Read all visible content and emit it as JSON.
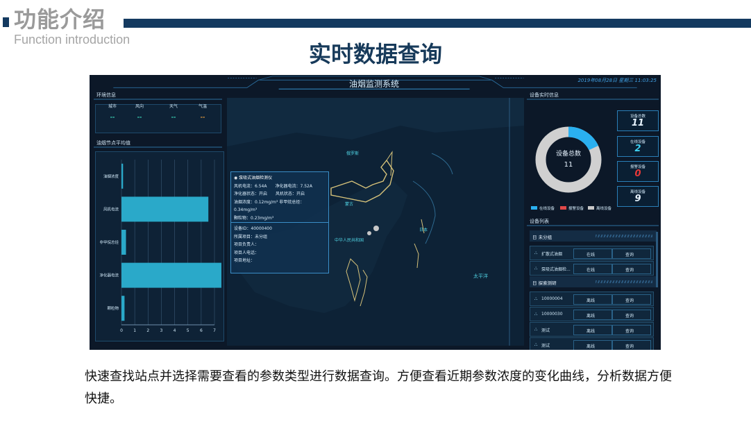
{
  "slide": {
    "title": "功能介绍",
    "subtitle": "Function introduction",
    "heading": "实时数据查询",
    "description": "快速查找站点并选择需要查看的参数类型进行数据查询。方便查看近期参数浓度的变化曲线，分析数据方便快捷。"
  },
  "app": {
    "title": "油烟监测系统",
    "datetime": "2019年08月28日 星期三 11:03:25"
  },
  "env": {
    "section_title": "环境信息",
    "columns": [
      {
        "label": "城市",
        "value": "--",
        "color": "#3fe0c0"
      },
      {
        "label": "风向",
        "value": "--",
        "color": "#3fe0c0"
      },
      {
        "label": "天气",
        "value": "--",
        "color": "#3fe0c0"
      },
      {
        "label": "气温",
        "value": "--",
        "color": "#f0a040"
      }
    ]
  },
  "avg": {
    "section_title": "油烟节点平均值",
    "chart_data": {
      "type": "bar",
      "orientation": "horizontal",
      "categories": [
        "油烟浓度",
        "风机电流",
        "非甲烷总烃",
        "净化器电流",
        "颗粒物"
      ],
      "values": [
        0.12,
        6.54,
        0.34,
        7.52,
        0.23
      ],
      "xticks": [
        "0",
        "1",
        "2",
        "3",
        "4",
        "5",
        "6",
        "7"
      ],
      "xlim": [
        0,
        7
      ],
      "color": "#2aa9c9"
    }
  },
  "map": {
    "labels": [
      "俄罗斯",
      "蒙古",
      "中华人民共和国",
      "日本",
      "太平洋"
    ],
    "popup1": {
      "device_name": "◉ 泵吸式油烟检测仪",
      "lines": [
        "风机电流：6.54A　　净化器电流：7.52A",
        "净化器状态：开启　　风机状态：开启",
        "油烟浓度：0.12mg/m³  非甲烷总烃：0.34mg/m³",
        "颗粒物：0.23mg/m³"
      ]
    },
    "popup2": {
      "lines": [
        "设备ID：40000400",
        "所属项目：未分组",
        "项目负责人：",
        "项目人电话：",
        "项目地址："
      ]
    }
  },
  "realtime": {
    "section_title": "设备实时信息",
    "donut": {
      "label": "设备总数",
      "total": "11",
      "online_fraction": 0.18,
      "color_online": "#2ab0f0",
      "color_offline": "#d0d0d0"
    },
    "legend": [
      "在线设备",
      "报警设备",
      "离线设备"
    ],
    "legend_colors": [
      "#2ab0f0",
      "#e04848",
      "#c8c8c8"
    ],
    "counters": [
      {
        "label": "设备总数",
        "value": "11",
        "color": "#e8f4ff"
      },
      {
        "label": "在线设备",
        "value": "2",
        "color": "#3fd0f0"
      },
      {
        "label": "报警设备",
        "value": "0",
        "color": "#e83838"
      },
      {
        "label": "离线设备",
        "value": "9",
        "color": "#e8f4ff"
      }
    ]
  },
  "device_list": {
    "section_title": "设备列表",
    "groups": [
      {
        "name": "日 未分组",
        "rows": [
          {
            "name": "扩散式油烟",
            "status": "在线",
            "action": "查询"
          },
          {
            "name": "泵吸式油烟检...",
            "status": "在线",
            "action": "查询"
          }
        ]
      },
      {
        "name": "日 探索测研",
        "rows": [
          {
            "name": "10000004",
            "status": "离线",
            "action": "查询"
          },
          {
            "name": "10000030",
            "status": "离线",
            "action": "查询"
          },
          {
            "name": "测试",
            "status": "离线",
            "action": "查询"
          },
          {
            "name": "测试",
            "status": "离线",
            "action": "查询"
          }
        ]
      }
    ]
  }
}
